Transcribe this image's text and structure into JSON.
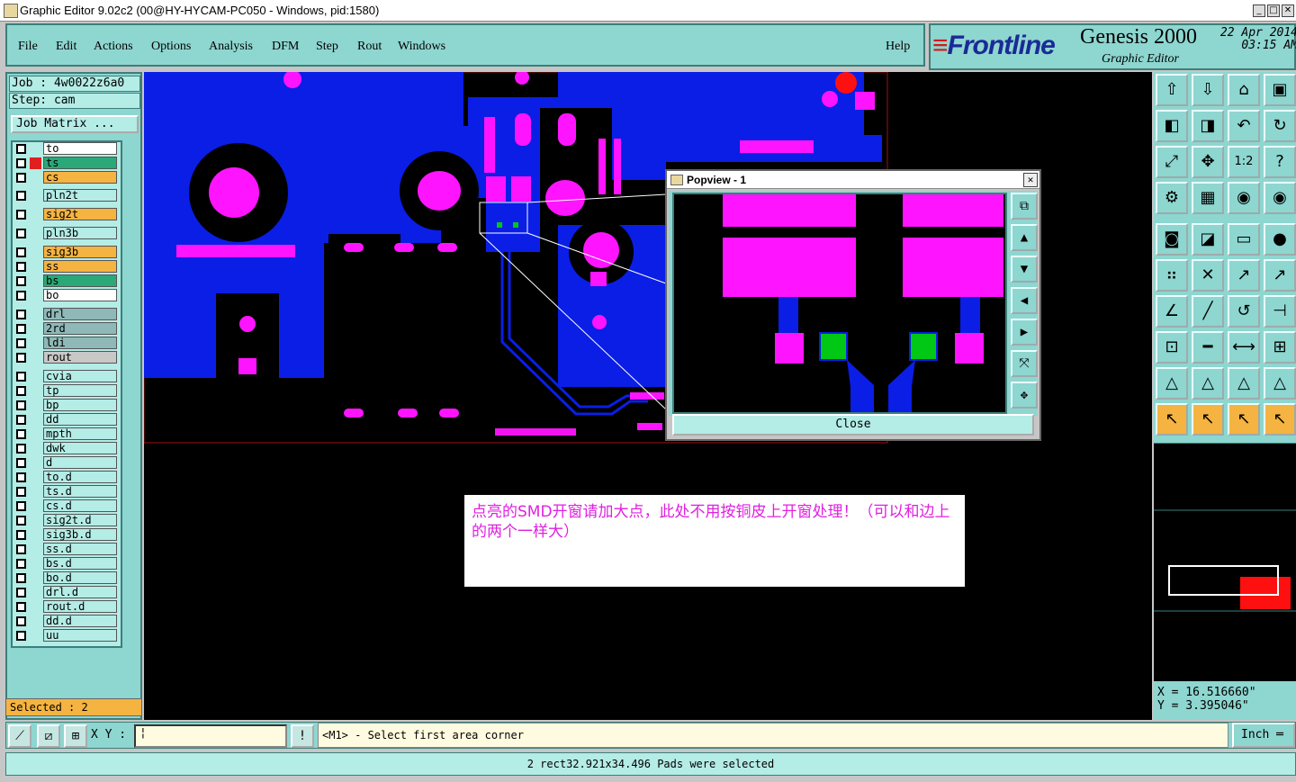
{
  "window": {
    "title": "Graphic Editor 9.02c2 (00@HY-HYCAM-PC050 - Windows, pid:1580)"
  },
  "menu": [
    "File",
    "Edit",
    "Actions",
    "Options",
    "Analysis",
    "DFM",
    "Step",
    "Rout",
    "Windows"
  ],
  "help_label": "Help",
  "brand": {
    "logo": "Frontline",
    "product": "Genesis 2000",
    "subtitle": "Graphic Editor",
    "date": "22 Apr 2014",
    "time": "03:15 AM"
  },
  "job": {
    "job_line": "Job : 4w0022z6a0",
    "step_line": "Step: cam",
    "matrix_button": "Job Matrix ..."
  },
  "layers": [
    "to",
    "ts",
    "cs",
    "pln2t",
    "sig2t",
    "pln3b",
    "sig3b",
    "ss",
    "bs",
    "bo",
    "drl",
    "2rd",
    "ldi",
    "rout",
    "cvia",
    "tp",
    "bp",
    "dd",
    "mpth",
    "dwk",
    "d",
    "to.d",
    "ts.d",
    "cs.d",
    "sig2t.d",
    "sig3b.d",
    "ss.d",
    "bs.d",
    "bo.d",
    "drl.d",
    "rout.d",
    "dd.d",
    "uu"
  ],
  "selected_label": "Selected : 2",
  "note_text": "点亮的SMD开窗请加大点，此处不用按铜皮上开窗处理！（可以和边上的两个一样大）",
  "popview": {
    "title": "Popview - 1",
    "close_label": "Close"
  },
  "coords": {
    "x": "X  =  16.516660\"",
    "y": "Y  =  3.395046\""
  },
  "bottom": {
    "xy_label": "X Y :",
    "prompt": "<M1> - Select first area corner",
    "unit": "Inch"
  },
  "status": "2 rect32.921x34.496 Pads were selected",
  "colors": {
    "panel": "#8ed6d0",
    "copper": "#0a1ee6",
    "pad": "#ff14ff",
    "selected_pad": "#00c814",
    "highlight": "#f5b341"
  },
  "tool_icons": [
    "zoom-home-icon",
    "zoom-out-icon",
    "home-icon",
    "window-icon",
    "pan-left-icon",
    "pan-right-icon",
    "undo-view-icon",
    "redraw-icon",
    "fit-icon",
    "center-icon",
    "scale-1-2-icon",
    "help-icon",
    "snap-icon",
    "grid-icon",
    "layer-a-icon",
    "layer-b-icon",
    "pad-add-icon",
    "polygon-icon",
    "measure-icon",
    "dot-icon",
    "connect-icon",
    "cross-icon",
    "line-arc-icon",
    "line-diag-icon",
    "angle-icon",
    "line-draw-icon",
    "arc-icon",
    "feature-icon",
    "move-icon",
    "dash-icon",
    "stretch-icon",
    "group-icon",
    "triangle-icon",
    "triangle-b-icon",
    "triangle-c-icon",
    "triangle-d-icon",
    "pointer-icon",
    "pointer-b-icon",
    "pointer-c-icon",
    "pointer-d-icon"
  ]
}
